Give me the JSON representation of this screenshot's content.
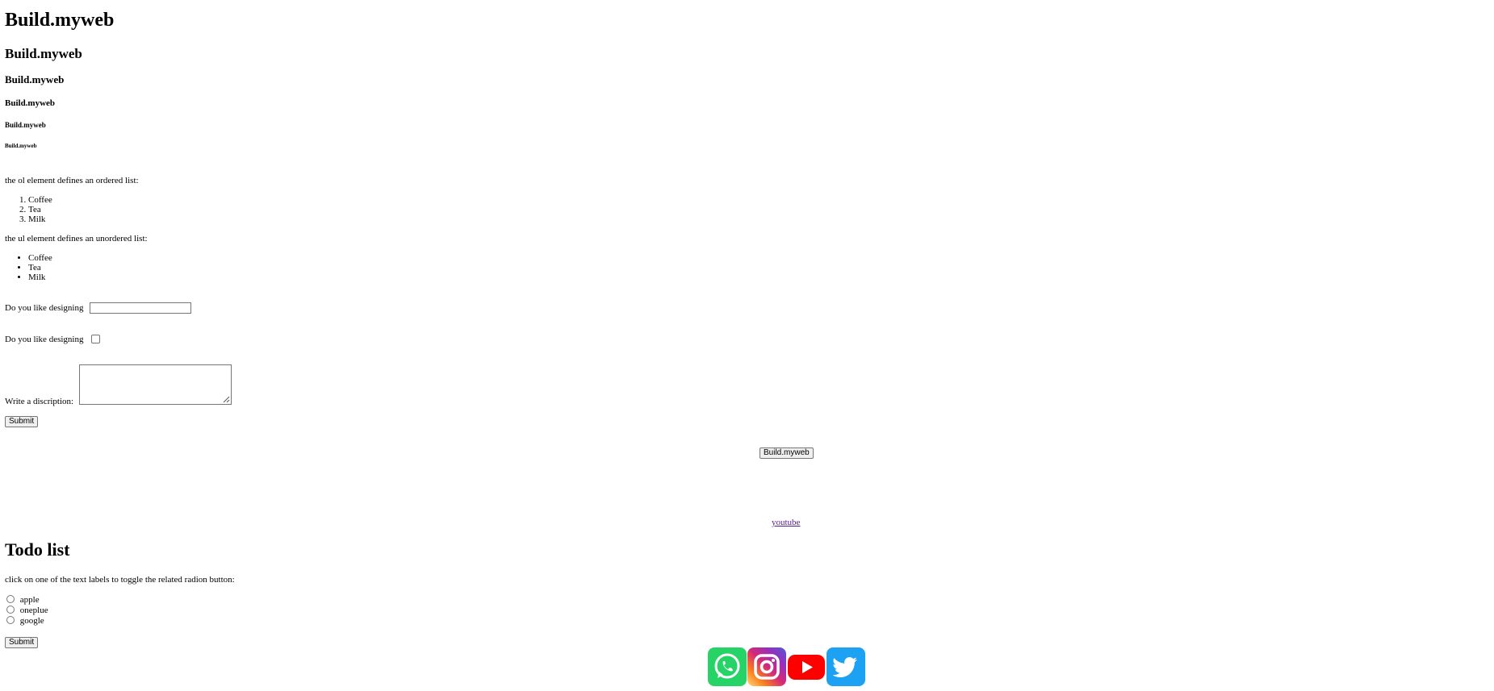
{
  "headings": {
    "h1": "Build.myweb",
    "h2": "Build.myweb",
    "h3": "Build.myweb",
    "h4": "Build.myweb",
    "h5": "Build.myweb",
    "h6": "Build.myweb"
  },
  "ordered": {
    "intro": "the ol element defines an ordered list:",
    "items": [
      "Coffee",
      "Tea",
      "Milk"
    ]
  },
  "unordered": {
    "intro": "the ul element defines an unordered list:",
    "items": [
      "Coffee",
      "Tea",
      "Milk"
    ]
  },
  "form": {
    "text_label": "Do you like designing",
    "text_value": "",
    "checkbox_label": "Do you like designing",
    "textarea_label": "Write a discription:",
    "textarea_value": "",
    "submit_label": "Submit"
  },
  "center": {
    "button_label": "Build.myweb",
    "link_text": "youtube"
  },
  "todo": {
    "title": "Todo list",
    "instructions": "click on one of the text labels to toggle the related radion button:",
    "options": [
      "apple",
      "oneplue",
      "google"
    ],
    "submit_label": "Submit"
  },
  "social_icons": [
    "whatsapp-icon",
    "instagram-icon",
    "youtube-icon",
    "twitter-icon"
  ],
  "colors": {
    "link": "#551a8b",
    "whatsapp": "#25d366",
    "youtube": "#ff0000",
    "twitter": "#1da1f2"
  }
}
